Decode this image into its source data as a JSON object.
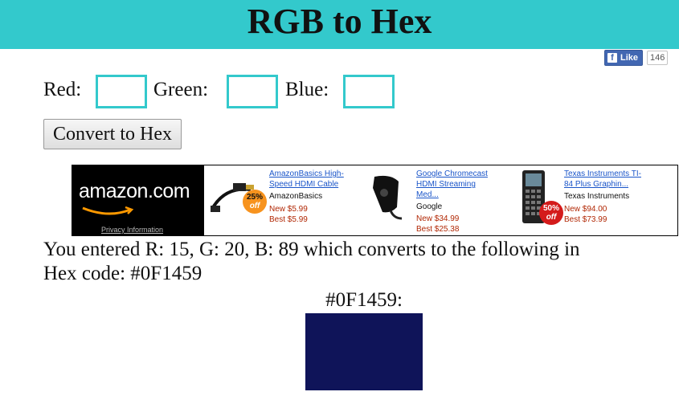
{
  "page": {
    "title": "RGB to Hex"
  },
  "facebook": {
    "like_label": "Like",
    "count": "146"
  },
  "form": {
    "red_label": "Red:",
    "green_label": "Green:",
    "blue_label": "Blue:",
    "red_value": "",
    "green_value": "",
    "blue_value": "",
    "convert_label": "Convert to Hex"
  },
  "ad": {
    "brand_text": "amazon.com",
    "privacy_label": "Privacy Information",
    "products": [
      {
        "title_line1": "AmazonBasics High-",
        "title_line2": "Speed HDMI Cable",
        "title_line3": "",
        "brand": "AmazonBasics",
        "new_price": "New $5.99",
        "best_price": "Best $5.99",
        "badge": "25%",
        "badge_sub": "off",
        "icon": "hdmi-cable-icon"
      },
      {
        "title_line1": "Google Chromecast",
        "title_line2": "HDMI Streaming",
        "title_line3": "Med...",
        "brand": "Google",
        "new_price": "New $34.99",
        "best_price": "Best $25.38",
        "badge": "",
        "badge_sub": "",
        "icon": "chromecast-icon"
      },
      {
        "title_line1": "Texas Instruments TI-",
        "title_line2": "84 Plus Graphin...",
        "title_line3": "",
        "brand": "Texas Instruments",
        "new_price": "New $94.00",
        "best_price": "Best $73.99",
        "badge": "50%",
        "badge_sub": "off",
        "icon": "calculator-icon"
      }
    ]
  },
  "result": {
    "line1": "You entered R: 15, G: 20, B: 89 which converts to the following in",
    "line2": "Hex code: #0F1459",
    "hex_label": "#0F1459:",
    "swatch_color": "#0F1459"
  },
  "colors": {
    "header_bg": "#33c9cc",
    "input_border": "#33c9cc"
  }
}
